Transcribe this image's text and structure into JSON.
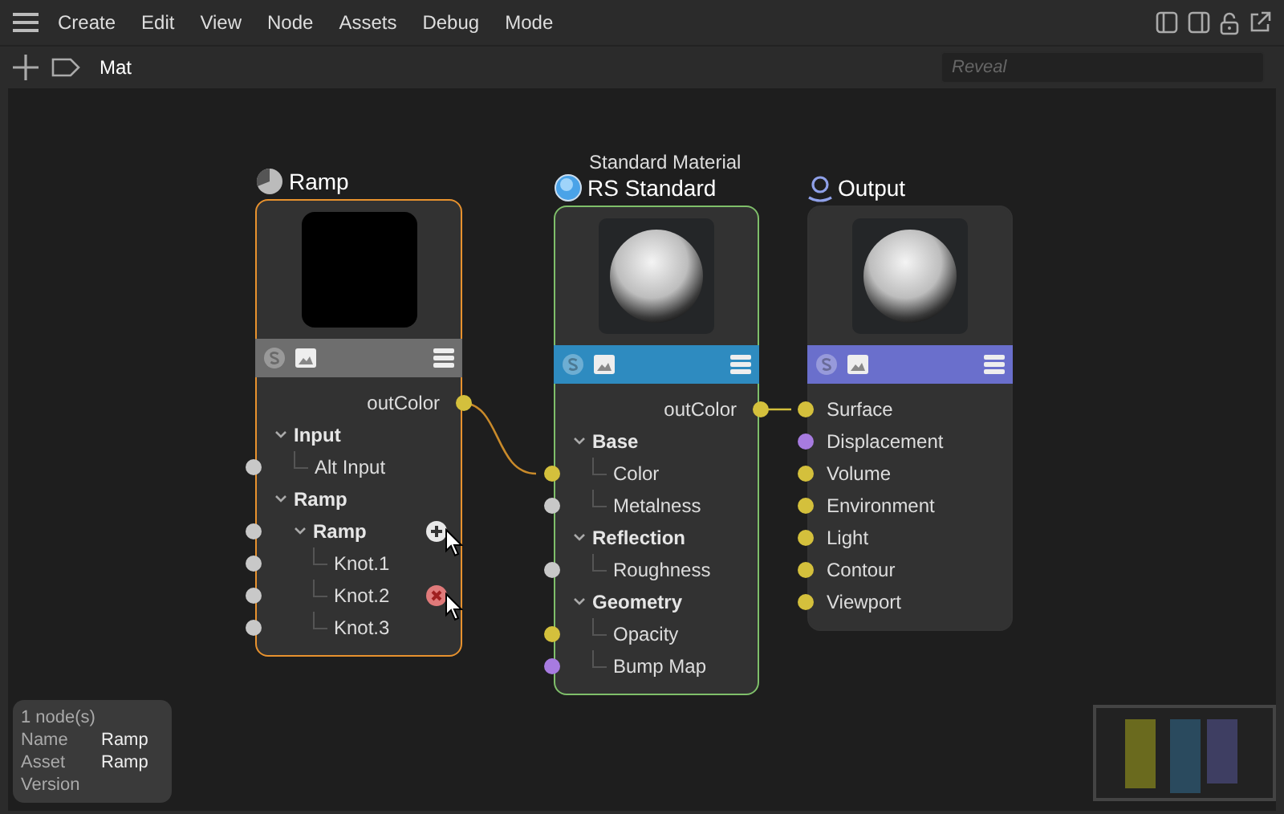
{
  "menu": [
    "Create",
    "Edit",
    "View",
    "Node",
    "Assets",
    "Debug",
    "Mode"
  ],
  "toolbar": {
    "path": "Mat",
    "search": {
      "placeholder": "Reveal"
    }
  },
  "nodes": [
    {
      "kind": "ramp",
      "title": "Ramp",
      "color": "#6e6e6e",
      "selected": true,
      "highlighted": false,
      "output": {
        "label": "outColor",
        "color": "#d4c03c"
      },
      "inputs": [
        {
          "kind": "group",
          "label": "Input",
          "expanded": true,
          "hovered": false,
          "children": [
            {
              "kind": "input",
              "label": "Alt Input",
              "color": "#c8c8c8",
              "hovered": false
            }
          ]
        },
        {
          "kind": "group",
          "label": "Ramp",
          "expanded": true,
          "hovered": false,
          "children": [
            {
              "kind": "group",
              "label": "Ramp",
              "expanded": true,
              "color": "#c8c8c8",
              "hovered": true,
              "children": [
                {
                  "kind": "input",
                  "label": "Knot.1",
                  "color": "#c8c8c8",
                  "hovered": false
                },
                {
                  "kind": "input",
                  "label": "Knot.2",
                  "color": "#c8c8c8",
                  "hovered": true
                },
                {
                  "kind": "input",
                  "label": "Knot.3",
                  "color": "#c8c8c8",
                  "hovered": false
                }
              ]
            }
          ]
        }
      ]
    },
    {
      "kind": "material",
      "subtitle": "Standard Material",
      "title": "RS Standard",
      "color": "#2e8bc0",
      "selected": false,
      "highlighted": true,
      "output": {
        "label": "outColor",
        "color": "#d4c03c"
      },
      "inputs": [
        {
          "kind": "group",
          "label": "Base",
          "expanded": true,
          "hovered": false,
          "children": [
            {
              "kind": "input",
              "label": "Color",
              "color": "#d4c03c",
              "hovered": false
            },
            {
              "kind": "input",
              "label": "Metalness",
              "color": "#c8c8c8",
              "hovered": false
            }
          ]
        },
        {
          "kind": "group",
          "label": "Reflection",
          "expanded": true,
          "hovered": false,
          "children": [
            {
              "kind": "input",
              "label": "Roughness",
              "color": "#c8c8c8",
              "hovered": false
            }
          ]
        },
        {
          "kind": "group",
          "label": "Geometry",
          "expanded": true,
          "hovered": false,
          "children": [
            {
              "kind": "input",
              "label": "Opacity",
              "color": "#d4c03c",
              "hovered": false
            },
            {
              "kind": "input",
              "label": "Bump Map",
              "color": "#a77be0",
              "hovered": false
            }
          ]
        }
      ]
    },
    {
      "kind": "output",
      "title": "Output",
      "color": "#6a6fcc",
      "selected": false,
      "highlighted": false,
      "inputs": [
        {
          "kind": "input",
          "label": "Surface",
          "color": "#d4c03c",
          "hovered": false
        },
        {
          "kind": "input",
          "label": "Displacement",
          "color": "#a77be0",
          "hovered": false
        },
        {
          "kind": "input",
          "label": "Volume",
          "color": "#d4c03c",
          "hovered": false
        },
        {
          "kind": "input",
          "label": "Environment",
          "color": "#d4c03c",
          "hovered": false
        },
        {
          "kind": "input",
          "label": "Light",
          "color": "#d4c03c",
          "hovered": false
        },
        {
          "kind": "input",
          "label": "Contour",
          "color": "#d4c03c",
          "hovered": false
        },
        {
          "kind": "input",
          "label": "Viewport",
          "color": "#d4c03c",
          "hovered": false
        }
      ]
    }
  ],
  "info": {
    "count": "1 node(s)",
    "fields": [
      {
        "label": "Name",
        "value": "Ramp"
      },
      {
        "label": "Asset",
        "value": "Ramp"
      },
      {
        "label": "Version"
      }
    ]
  }
}
